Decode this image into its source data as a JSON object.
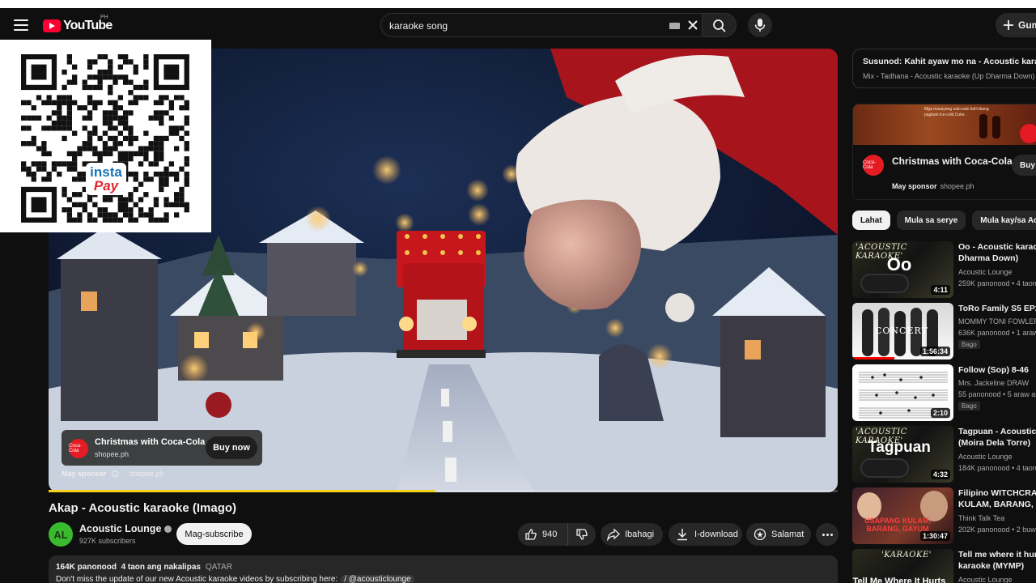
{
  "header": {
    "logo_text": "YouTube",
    "country_code": "PH",
    "search": {
      "value": "karaoke song",
      "placeholder": "Search"
    },
    "create_label": "Gum"
  },
  "player": {
    "progress": 0.49,
    "overlay_ad": {
      "title": "Christmas with Coca-Cola",
      "domain": "shopee.ph",
      "buy_label": "Buy now",
      "sponsor_label": "May sponsor",
      "sponsor_domain": "shopee.ph",
      "logo_text": "Coca-Cola"
    },
    "qr_logo_top": "insta",
    "qr_logo_bottom": "Pay"
  },
  "video": {
    "title": "Akap - Acoustic karaoke (Imago)",
    "channel": {
      "name": "Acoustic Lounge",
      "subscribers": "927K subscribers",
      "avatar_text": "AL"
    },
    "subscribe_label": "Mag-subscribe",
    "actions": {
      "likes": "940",
      "share": "Ibahagi",
      "download": "I-download",
      "thanks": "Salamat"
    },
    "description": {
      "views": "164K panonood",
      "age": "4 taon ang nakalipas",
      "location": "QATAR",
      "text": "Don't miss the update of our new Acoustic karaoke videos by subscribing here:",
      "link": "/ @acousticlounge"
    }
  },
  "sidebar": {
    "up_next": {
      "title": "Susunod: Kahit ayaw mo na - Acoustic karaoke",
      "subtitle": "Mix - Tadhana - Acoustic karaoke (Up Dharma Down)"
    },
    "ad": {
      "banner_text": "Mga masayang salo-salo ilat't-ibang pagkain Ice-cold Coke.",
      "title": "Christmas with Coca-Cola",
      "sponsor_label": "May sponsor",
      "domain": "shopee.ph",
      "buy_label": "Buy",
      "logo_text": "Coca-Cola"
    },
    "chips": [
      {
        "label": "Lahat",
        "active": true
      },
      {
        "label": "Mula sa serye",
        "active": false
      },
      {
        "label": "Mula kay/sa Acou",
        "active": false
      }
    ],
    "recommendations": [
      {
        "title_1": "Oo - Acoustic karaok",
        "title_2": "Dharma Down)",
        "channel": "Acoustic Lounge",
        "meta": "259K panonood • 4 taon",
        "duration": "4:11",
        "thumb_label": "'ACOUSTIC KARAOKE'",
        "thumb_text": "Oo"
      },
      {
        "title_1": "ToRo Family S5 EP23",
        "channel": "MOMMY TONI FOWLER",
        "meta": "636K panonood • 1 araw",
        "badge": "Bago",
        "duration": "1:56:34",
        "thumb_text": "CONCERT"
      },
      {
        "title_1": "Follow (Sop) 8-46",
        "channel": "Mrs. Jackeline DRAW",
        "meta": "55 panonood • 5 araw ar",
        "badge": "Bago",
        "duration": "2:10"
      },
      {
        "title_1": "Tagpuan - Acoustic k",
        "title_2": "(Moira Dela Torre)",
        "channel": "Acoustic Lounge",
        "meta": "184K panonood • 4 taon",
        "duration": "4:32",
        "thumb_label": "'ACOUSTIC KARAOKE'",
        "thumb_text": "Tagpuan"
      },
      {
        "title_1": "Filipino WITCHCRAF",
        "title_2": "KULAM, BARANG, Ba",
        "channel": "Think Talk Tea",
        "meta": "202K panonood • 2 buwa",
        "duration": "1:30:47",
        "thumb_text": "USAPANG KULAM, BARANG, GAYUM"
      },
      {
        "title_1": "Tell me where it hurts",
        "title_2": "karaoke (MYMP)",
        "channel": "Acoustic Lounge",
        "thumb_label": "'KARAOKE'",
        "thumb_text": "Tell Me Where It Hurts"
      }
    ]
  },
  "colors": {
    "background": "#0f0f0f",
    "brand_red": "#ff0033",
    "progress": "#f7d21b",
    "coca_cola": "#e41b23",
    "avatar_green": "#3aba2e"
  }
}
